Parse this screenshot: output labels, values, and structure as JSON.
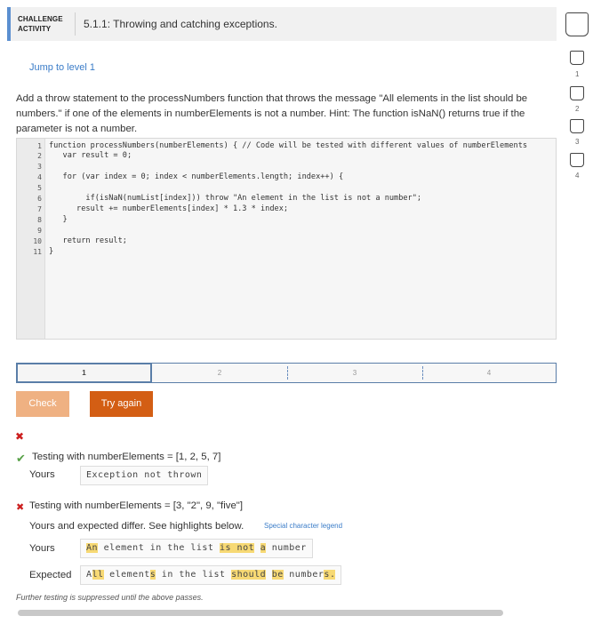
{
  "header": {
    "badge_line1": "CHALLENGE",
    "badge_line2": "ACTIVITY",
    "title": "5.1.1: Throwing and catching exceptions."
  },
  "levels": [
    {
      "label": "1"
    },
    {
      "label": "2"
    },
    {
      "label": "3"
    },
    {
      "label": "4"
    }
  ],
  "jump_link": "Jump to level 1",
  "instructions": "Add a throw statement to the processNumbers function that throws the message \"All elements in the list should be numbers.\" if one of the elements in numberElements is not a number. Hint: The function isNaN() returns true if the parameter is not a number.",
  "editor": {
    "line_numbers": [
      "1",
      "2",
      "3",
      "4",
      "5",
      "6",
      "7",
      "8",
      "9",
      "10",
      "11"
    ],
    "lines": [
      "function processNumbers(numberElements) { // Code will be tested with different values of numberElements",
      "   var result = 0;",
      "",
      "   for (var index = 0; index < numberElements.length; index++) {",
      "",
      "        if(isNaN(numList[index])) throw \"An element in the list is not a number\";",
      "      result += numberElements[index] * 1.3 * index;",
      "   }",
      "",
      "   return result;",
      "}"
    ]
  },
  "progress": {
    "segments": [
      "1",
      "2",
      "3",
      "4"
    ],
    "active": 1
  },
  "buttons": {
    "check": "Check",
    "try_again": "Try again"
  },
  "results": {
    "fail_mark": "✖",
    "test1": {
      "mark": "✔",
      "label": "Testing with numberElements = [1, 2, 5, 7]",
      "yours_label": "Yours",
      "yours_value": "Exception not thrown"
    },
    "test2": {
      "mark": "✖",
      "label": "Testing with numberElements = [3, \"2\", 9, \"five\"]",
      "differ_text": "Yours and expected differ. See highlights below.",
      "legend_link": "Special character legend",
      "yours_label": "Yours",
      "expected_label": "Expected",
      "yours_value": "An element in the list is not a number",
      "expected_value": "All elements in the list should be numbers."
    },
    "further": "Further testing is suppressed until the above passes."
  },
  "colors": {
    "accent": "#5b8fd0",
    "check_button": "#efb182",
    "try_again_button": "#d35e14",
    "highlight": "#f7d974",
    "error": "#cc1f1f",
    "success": "#58a148"
  }
}
